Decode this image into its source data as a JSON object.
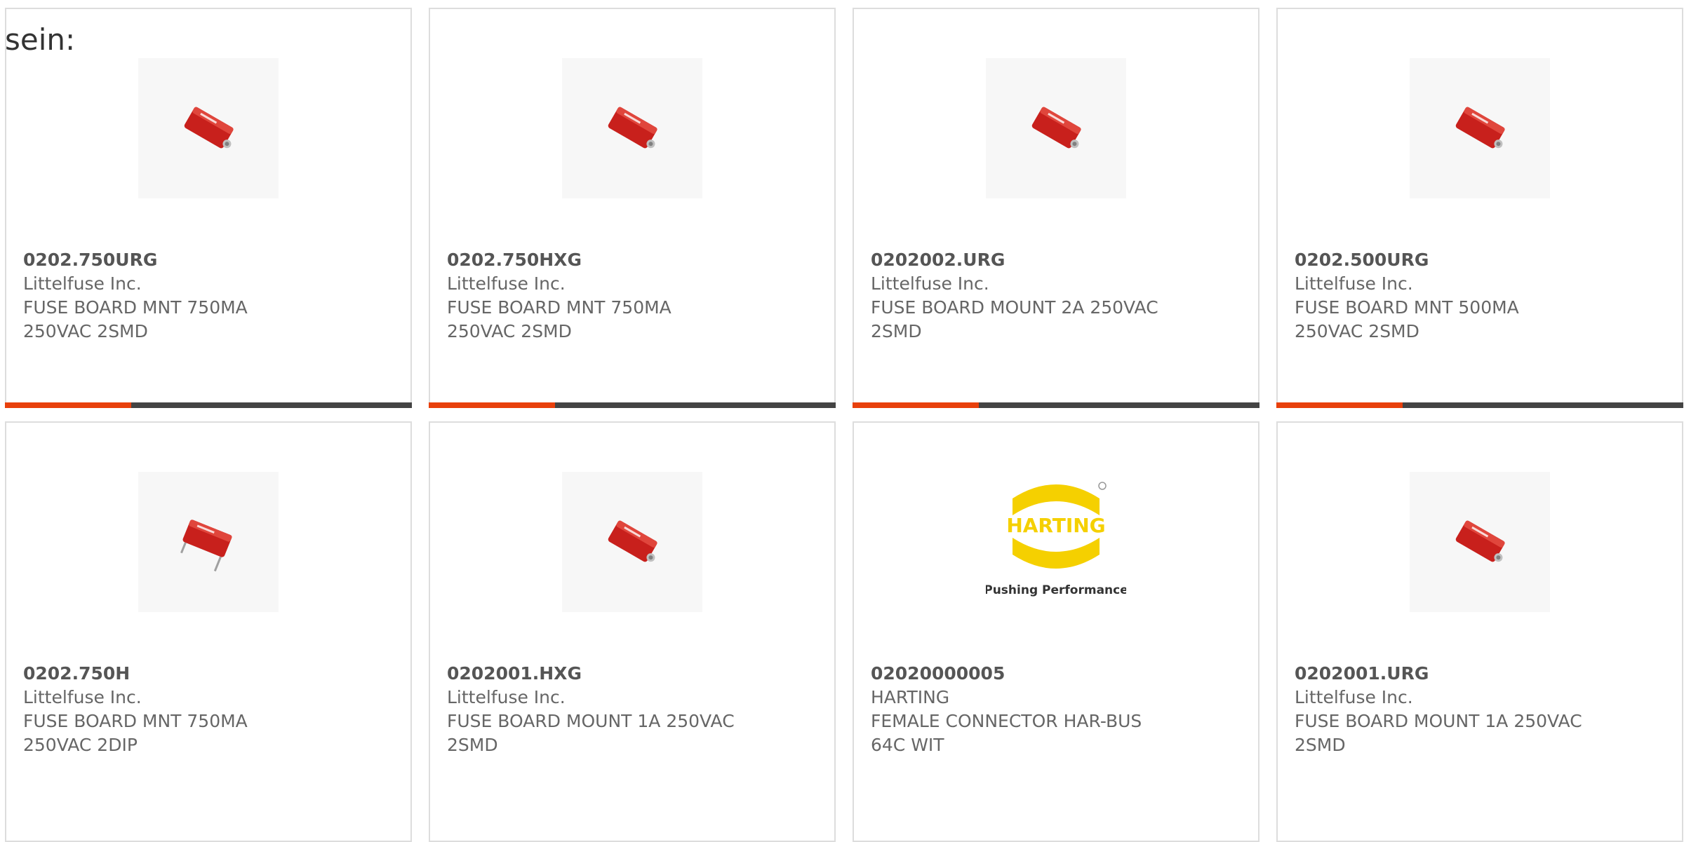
{
  "intro_text": "sein:",
  "accent_color": "#e8400c",
  "bar_color": "#444444",
  "products": [
    {
      "part": "0202.750URG",
      "maker": "Littelfuse Inc.",
      "desc1": "FUSE BOARD MNT 750MA",
      "desc2": "250VAC 2SMD",
      "image": "fuse-image",
      "progress": 0.31
    },
    {
      "part": "0202.750HXG",
      "maker": "Littelfuse Inc.",
      "desc1": "FUSE BOARD MNT 750MA",
      "desc2": "250VAC 2SMD",
      "image": "fuse-image",
      "progress": 0.31
    },
    {
      "part": "0202002.URG",
      "maker": "Littelfuse Inc.",
      "desc1": "FUSE BOARD MOUNT 2A 250VAC",
      "desc2": "2SMD",
      "image": "fuse-image",
      "progress": 0.31
    },
    {
      "part": "0202.500URG",
      "maker": "Littelfuse Inc.",
      "desc1": "FUSE BOARD MNT 500MA",
      "desc2": "250VAC 2SMD",
      "image": "fuse-image",
      "progress": 0.31
    },
    {
      "part": "0202.750H",
      "maker": "Littelfuse Inc.",
      "desc1": "FUSE BOARD MNT 750MA",
      "desc2": "250VAC 2DIP",
      "image": "fuse-image"
    },
    {
      "part": "0202001.HXG",
      "maker": "Littelfuse Inc.",
      "desc1": "FUSE BOARD MOUNT 1A 250VAC",
      "desc2": "2SMD",
      "image": "fuse-image"
    },
    {
      "part": "02020000005",
      "maker": "HARTING",
      "desc1": "FEMALE CONNECTOR HAR-BUS",
      "desc2": "64C WIT",
      "image": "harting-logo",
      "logo_text": "HARTING",
      "logo_tagline": "Pushing Performance"
    },
    {
      "part": "0202001.URG",
      "maker": "Littelfuse Inc.",
      "desc1": "FUSE BOARD MOUNT 1A 250VAC",
      "desc2": "2SMD",
      "image": "fuse-image"
    }
  ]
}
